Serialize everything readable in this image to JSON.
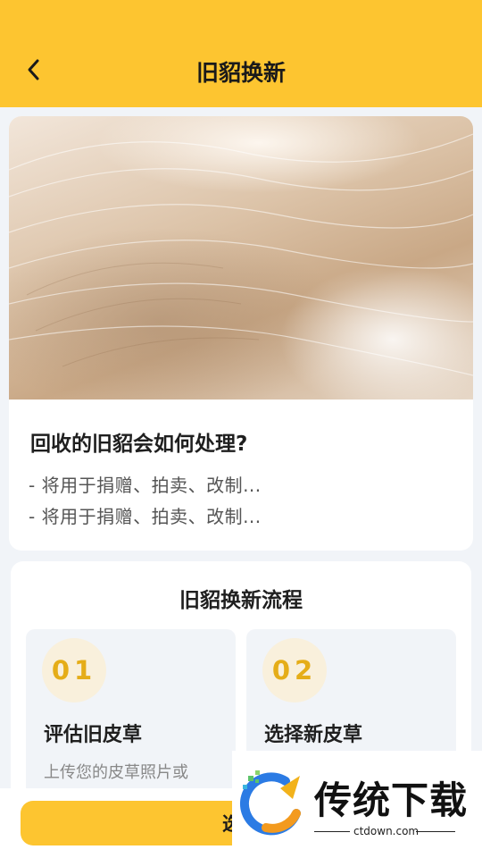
{
  "header": {
    "title": "旧貂换新"
  },
  "info_card": {
    "question": "回收的旧貂会如何处理?",
    "lines": [
      "- 将用于捐赠、拍卖、改制...",
      "- 将用于捐赠、拍卖、改制..."
    ]
  },
  "process": {
    "title": "旧貂换新流程",
    "steps": [
      {
        "number": "01",
        "name": "评估旧皮草",
        "desc": "上传您的皮草照片或"
      },
      {
        "number": "02",
        "name": "选择新皮草",
        "desc": ""
      }
    ]
  },
  "cta": {
    "label": "选款"
  },
  "watermark": {
    "brand": "传统下载",
    "url": "ctdown.com"
  },
  "colors": {
    "accent": "#fdc530",
    "step_number": "#e5ad18"
  },
  "icons": {
    "back": "chevron-left-icon"
  }
}
